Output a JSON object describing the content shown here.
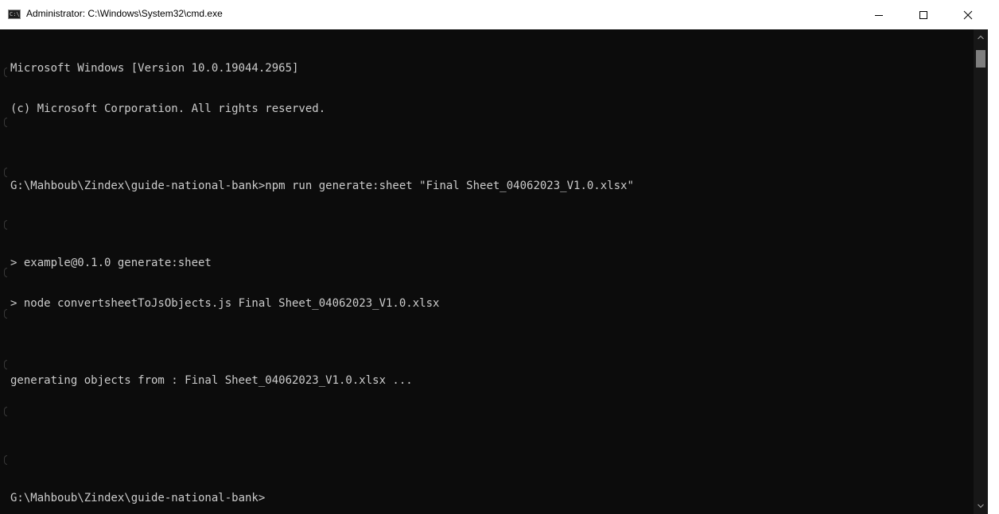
{
  "window": {
    "title": "Administrator: C:\\Windows\\System32\\cmd.exe",
    "icon": "cmd-icon",
    "icon_text": "C:\\",
    "buttons": {
      "minimize": "minimize-icon",
      "maximize": "maximize-icon",
      "close": "close-icon"
    }
  },
  "console": {
    "text_color": "#cccccc",
    "background": "#0c0c0c",
    "lines": [
      "Microsoft Windows [Version 10.0.19044.2965]",
      "(c) Microsoft Corporation. All rights reserved.",
      "",
      "G:\\Mahboub\\Zindex\\guide-national-bank>npm run generate:sheet \"Final Sheet_04062023_V1.0.xlsx\"",
      "",
      "> example@0.1.0 generate:sheet",
      "> node convertsheetToJsObjects.js Final Sheet_04062023_V1.0.xlsx",
      "",
      "generating objects from : Final Sheet_04062023_V1.0.xlsx ...",
      "",
      "",
      "G:\\Mahboub\\Zindex\\guide-national-bank>"
    ]
  },
  "scrollbar": {
    "up_icon": "scroll-up-arrow-icon",
    "down_icon": "scroll-down-arrow-icon",
    "thumb_color": "#7f7f7f"
  }
}
